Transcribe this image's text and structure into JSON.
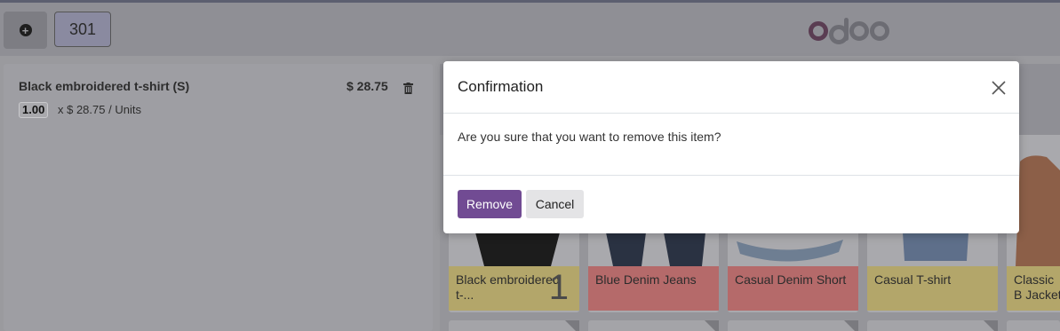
{
  "header": {
    "new_order_icon": "plus-circle-icon",
    "table_label": "301",
    "logo_text": "odoo"
  },
  "order": {
    "lines": [
      {
        "product_name": "Black embroidered t-shirt (S)",
        "price": "$ 28.75",
        "quantity": "1.00",
        "unit_info": "x $ 28.75 / Units",
        "delete_icon": "trash-icon"
      }
    ]
  },
  "products": [
    {
      "name": "Black embroidered t-...",
      "qty_badge": "1",
      "color": "#ffe082"
    },
    {
      "name": "Blue Denim Jeans",
      "color": "#ef9a9a"
    },
    {
      "name": "Casual Denim Short",
      "color": "#ef9a9a"
    },
    {
      "name": "Casual T-shirt",
      "color": "#ffe082"
    },
    {
      "name": "Classic B Jacket",
      "color": "#ffe082"
    }
  ],
  "dialog": {
    "title": "Confirmation",
    "message": "Are you sure that you want to remove this item?",
    "confirm_label": "Remove",
    "cancel_label": "Cancel",
    "close_icon": "close-icon"
  },
  "colors": {
    "primary": "#714b93",
    "overlay": "rgba(0,0,0,0.4)"
  }
}
